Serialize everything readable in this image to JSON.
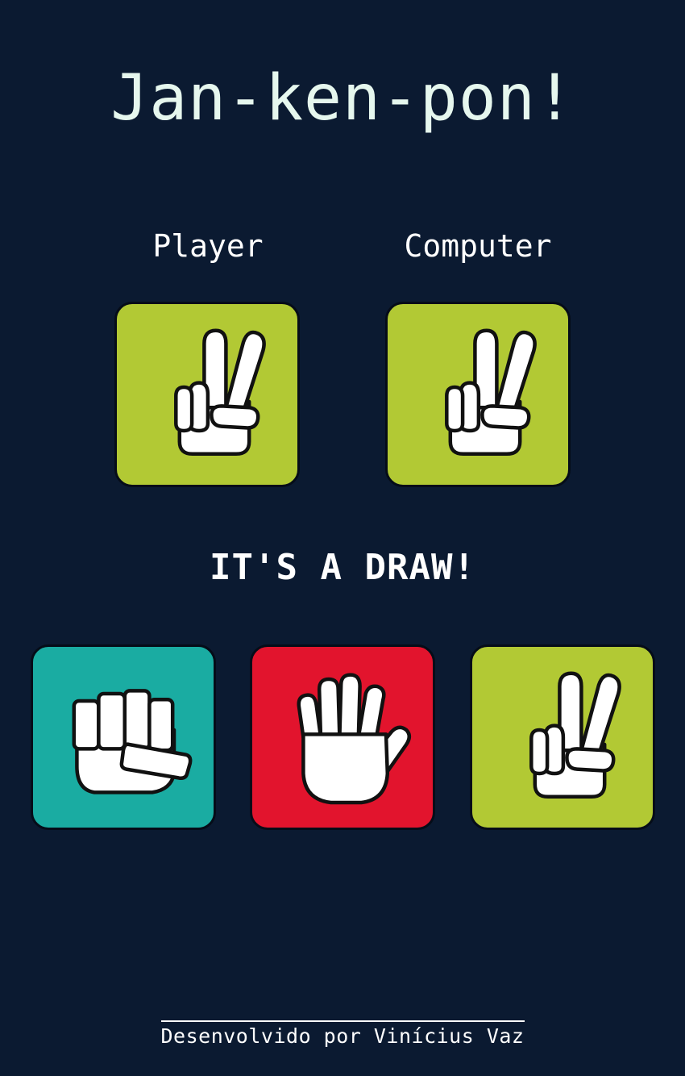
{
  "title": "Jan-ken-pon!",
  "labels": {
    "player": "Player",
    "computer": "Computer"
  },
  "player_choice": {
    "icon": "scissors-hand-icon",
    "color": "#b2c934"
  },
  "computer_choice": {
    "icon": "scissors-hand-icon",
    "color": "#b2c934"
  },
  "result": "IT'S A DRAW!",
  "choices": [
    {
      "id": "rock",
      "icon": "rock-fist-icon",
      "color": "#1aaca2"
    },
    {
      "id": "paper",
      "icon": "paper-hand-icon",
      "color": "#e2142d"
    },
    {
      "id": "scissors",
      "icon": "scissors-hand-icon",
      "color": "#b2c934"
    }
  ],
  "footer": "Desenvolvido por Vinícius Vaz",
  "colors": {
    "background": "#0b1a31",
    "text": "#e6f7ee"
  }
}
